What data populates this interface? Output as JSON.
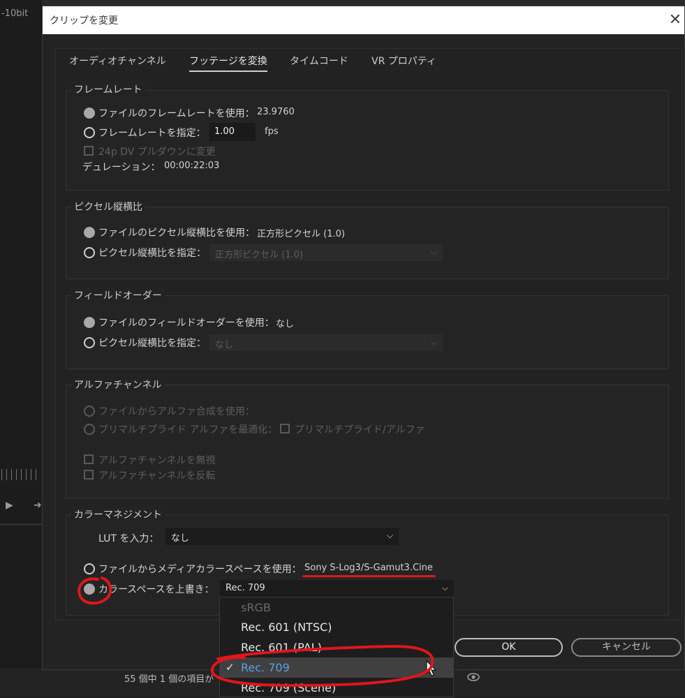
{
  "background": {
    "top_left_label": "-10bit",
    "status_text": "55 個中 1 個の項目が"
  },
  "dialog": {
    "title": "クリップを変更",
    "tabs": [
      "オーディオチャンネル",
      "フッテージを変換",
      "タイムコード",
      "VR プロパティ"
    ],
    "frame_rate": {
      "title": "フレームレート",
      "use_file_label": "ファイルのフレームレートを使用：",
      "file_rate": "23.9760",
      "assume_label": "フレームレートを指定：",
      "assume_value": "1.00",
      "fps_unit": "fps",
      "pulldown_label": "24p DV プルダウンに変更",
      "duration_label": "デュレーション：",
      "duration_value": "00:00:22:03"
    },
    "pixel_aspect": {
      "title": "ピクセル縦横比",
      "use_file_label": "ファイルのピクセル縦横比を使用：",
      "file_value": "正方形ピクセル (1.0)",
      "conform_label": "ピクセル縦横比を指定：",
      "conform_value": "正方形ピクセル (1.0)"
    },
    "field_order": {
      "title": "フィールドオーダー",
      "use_file_label": "ファイルのフィールドオーダーを使用：",
      "file_value": "なし",
      "conform_label": "ピクセル縦横比を指定：",
      "conform_value": "なし"
    },
    "alpha": {
      "title": "アルファチャンネル",
      "use_file_label": "ファイルからアルファ合成を使用：",
      "premult_label": "プリマルチプライド アルファを最適化：",
      "premult_check_label": "プリマルチプライド/アルファ",
      "ignore_label": "アルファチャンネルを無視",
      "invert_label": "アルファチャンネルを反転"
    },
    "color": {
      "title": "カラーマネジメント",
      "lut_label": "LUT を入力：",
      "lut_value": "なし",
      "use_media_label": "ファイルからメディアカラースペースを使用：",
      "media_value": "Sony S-Log3/S-Gamut3.Cine",
      "override_label": "カラースペースを上書き：",
      "override_value": "Rec. 709"
    },
    "dropdown_items": [
      "sRGB",
      "Rec. 601 (NTSC)",
      "Rec. 601 (PAL)",
      "Rec. 709",
      "Rec. 709 (Scene)"
    ],
    "ok_label": "OK",
    "cancel_label": "キャンセル"
  },
  "colors": {
    "annotation_red": "#e0161b",
    "selected_item_text": "#5aa0e8"
  }
}
